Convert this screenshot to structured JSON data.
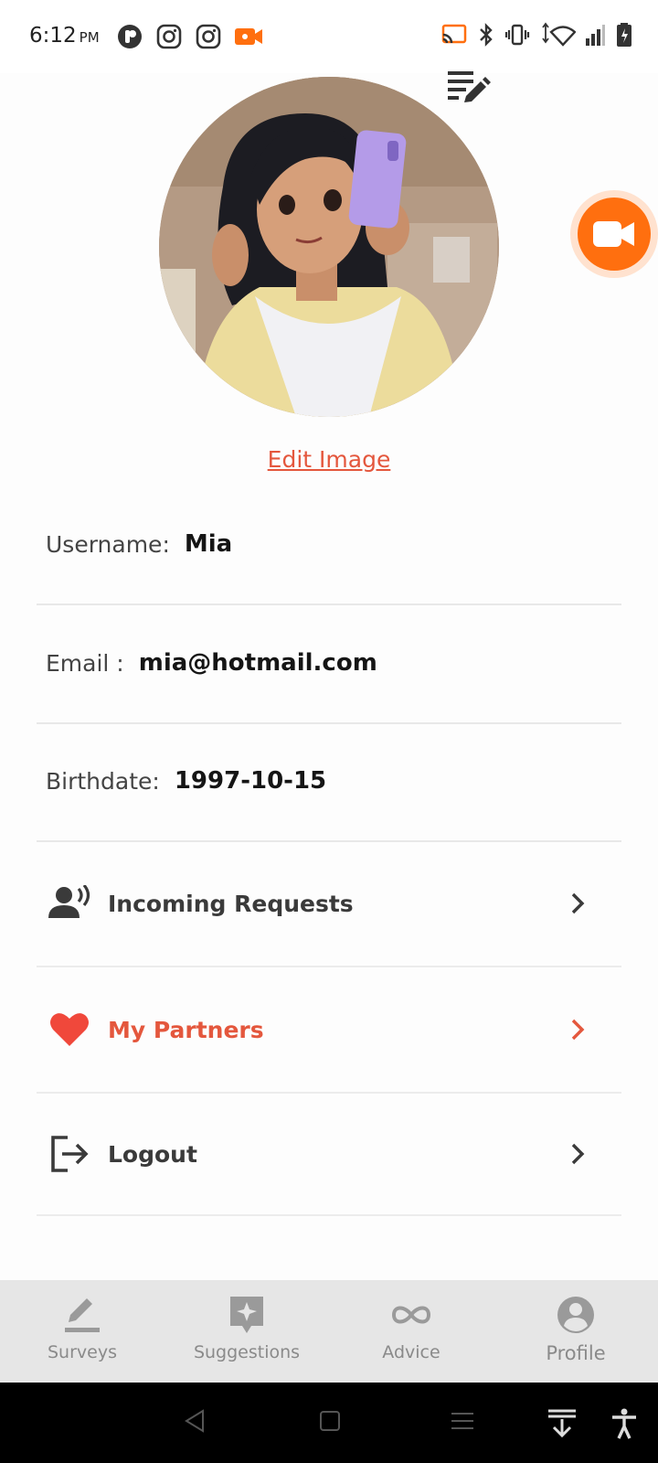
{
  "status_bar": {
    "time": "6:12",
    "ampm": "PM"
  },
  "profile": {
    "edit_image_label": "Edit Image"
  },
  "fields": [
    {
      "label": "Username:",
      "value": "Mia"
    },
    {
      "label": "Email :",
      "value": "mia@hotmail.com"
    },
    {
      "label": "Birthdate:",
      "value": "1997-10-15"
    }
  ],
  "menu": [
    {
      "label": "Incoming Requests",
      "icon": "incoming-requests-icon"
    },
    {
      "label": "My Partners",
      "icon": "heart-icon",
      "active": true
    },
    {
      "label": "Logout",
      "icon": "logout-icon"
    }
  ],
  "bottom_nav": [
    {
      "label": "Surveys",
      "icon": "pencil-icon"
    },
    {
      "label": "Suggestions",
      "icon": "sparkle-icon"
    },
    {
      "label": "Advice",
      "icon": "infinity-icon"
    },
    {
      "label": "Profile",
      "icon": "profile-icon",
      "active": true
    }
  ],
  "colors": {
    "accent": "#e4573d",
    "fab": "#ff6f0f",
    "nav_bg": "#e6e6e6"
  }
}
